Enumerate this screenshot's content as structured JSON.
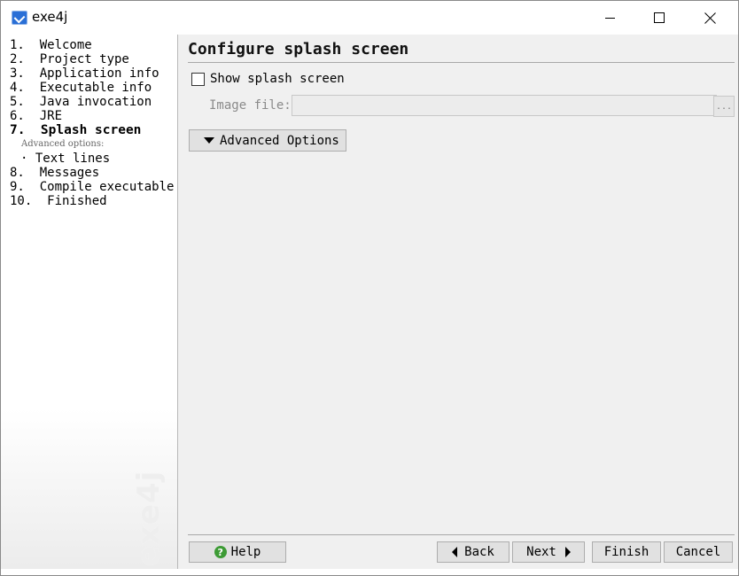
{
  "window": {
    "title": "exe4j",
    "icon": "exe4j-app-icon",
    "controls": [
      "minimize-icon",
      "maximize-icon",
      "close-icon"
    ]
  },
  "nav": {
    "items": [
      {
        "label": "1.  Welcome"
      },
      {
        "label": "2.  Project type"
      },
      {
        "label": "3.  Application info"
      },
      {
        "label": "4.  Executable info"
      },
      {
        "label": "5.  Java invocation"
      },
      {
        "label": "6.  JRE"
      },
      {
        "label": "7.  Splash screen"
      },
      {
        "label": "8.  Messages"
      },
      {
        "label": "9.  Compile executable"
      },
      {
        "label": "10.  Finished"
      }
    ],
    "active_index": 6,
    "advanced_caption": "Advanced options:",
    "sub_items": [
      {
        "label": "· Text lines"
      }
    ],
    "watermark": "exe4j"
  },
  "page": {
    "title": "Configure splash screen",
    "show_splash_label": "Show splash screen",
    "show_splash_checked": false,
    "image_file_label": "Image file:",
    "image_file_value": "",
    "browse_label": "...",
    "advanced_options_label": "Advanced Options"
  },
  "footer": {
    "help_label": "Help",
    "back_label": "Back",
    "next_label": "Next",
    "finish_label": "Finish",
    "cancel_label": "Cancel"
  },
  "colors": {
    "content_bg": "#f0f0f0",
    "button_bg": "#e1e1e1",
    "help_icon": "#3d9b35"
  }
}
